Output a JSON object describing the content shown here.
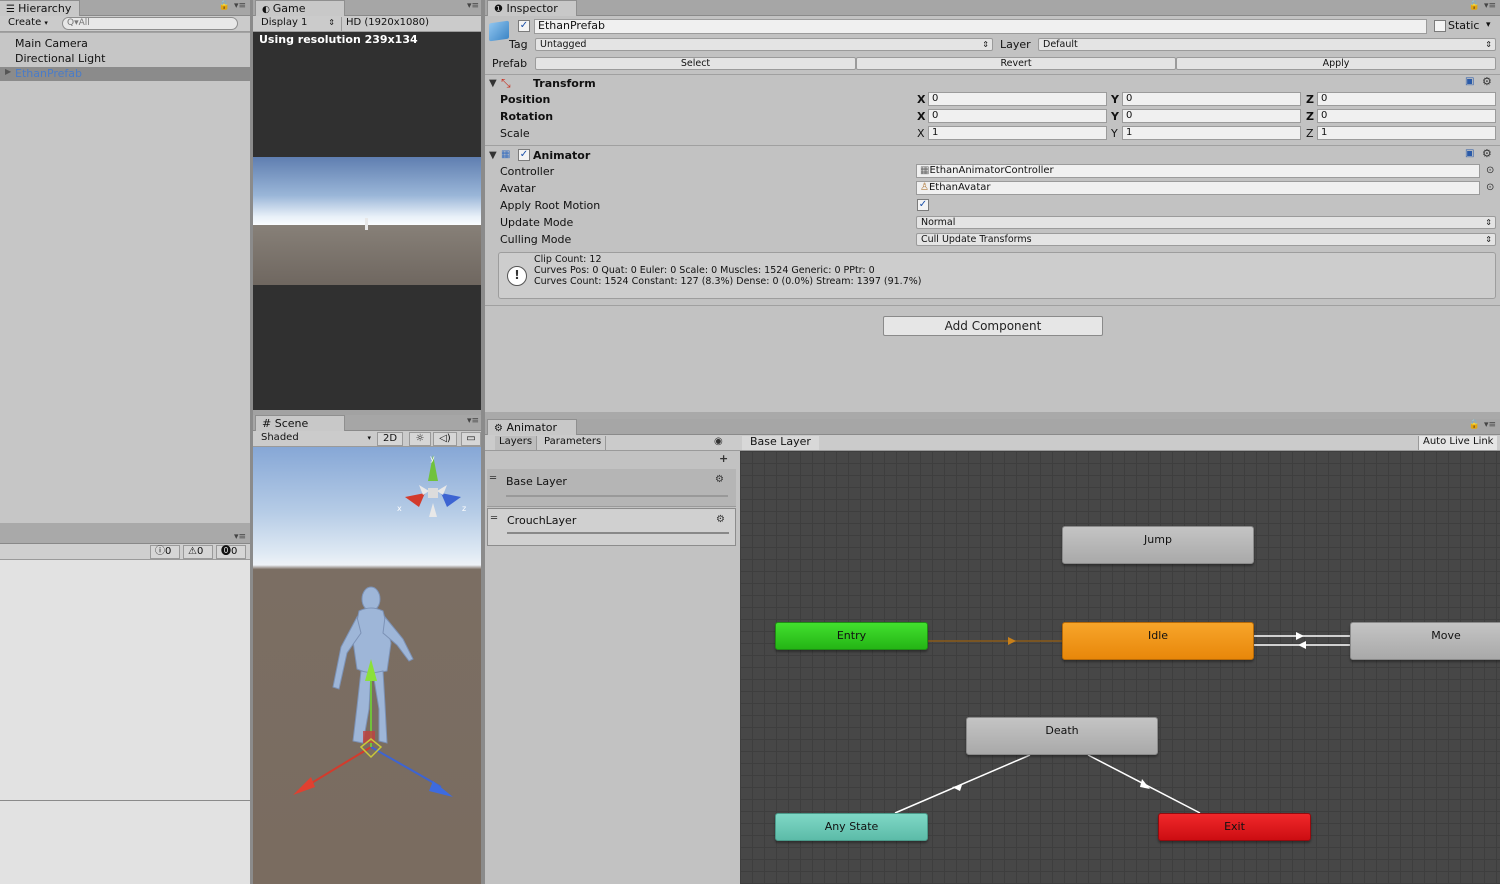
{
  "hierarchy": {
    "tab": "Hierarchy",
    "create": "Create",
    "search_placeholder": "Q▾All",
    "items": [
      "Main Camera",
      "Directional Light",
      "EthanPrefab"
    ]
  },
  "console_counts": {
    "info": "0",
    "warn": "0",
    "error": "0"
  },
  "game": {
    "tab": "Game",
    "display": "Display 1",
    "resolution": "HD (1920x1080)",
    "overlay": "Using resolution 239x134"
  },
  "scene": {
    "tab": "Scene",
    "shading": "Shaded",
    "mode_2d": "2D",
    "gizmo": {
      "y": "y",
      "x": "x",
      "z": "z"
    }
  },
  "inspector": {
    "tab": "Inspector",
    "object_name": "EthanPrefab",
    "static_label": "Static",
    "tag_label": "Tag",
    "tag_value": "Untagged",
    "layer_label": "Layer",
    "layer_value": "Default",
    "prefab_label": "Prefab",
    "prefab_buttons": [
      "Select",
      "Revert",
      "Apply"
    ],
    "transform": {
      "title": "Transform",
      "rows": [
        {
          "label": "Position",
          "x": "0",
          "y": "0",
          "z": "0"
        },
        {
          "label": "Rotation",
          "x": "0",
          "y": "0",
          "z": "0"
        },
        {
          "label": "Scale",
          "x": "1",
          "y": "1",
          "z": "1"
        }
      ]
    },
    "animator": {
      "title": "Animator",
      "controller_label": "Controller",
      "controller_value": "EthanAnimatorController",
      "avatar_label": "Avatar",
      "avatar_value": "EthanAvatar",
      "root_motion_label": "Apply Root Motion",
      "update_mode_label": "Update Mode",
      "update_mode_value": "Normal",
      "culling_mode_label": "Culling Mode",
      "culling_mode_value": "Cull Update Transforms",
      "info_line1": "Clip Count: 12",
      "info_line2": "Curves Pos: 0 Quat: 0 Euler: 0 Scale: 0 Muscles: 1524 Generic: 0 PPtr: 0",
      "info_line3": "Curves Count: 1524 Constant: 127 (8.3%) Dense: 0 (0.0%) Stream: 1397 (91.7%)"
    },
    "add_component": "Add Component"
  },
  "animator_window": {
    "tab": "Animator",
    "layers_tab": "Layers",
    "parameters_tab": "Parameters",
    "breadcrumb": "Base Layer",
    "auto_live_link": "Auto Live Link",
    "layers": [
      "Base Layer",
      "CrouchLayer"
    ],
    "nodes": {
      "jump": "Jump",
      "entry": "Entry",
      "idle": "Idle",
      "move": "Move",
      "death": "Death",
      "any_state": "Any State",
      "exit": "Exit"
    }
  },
  "colors": {
    "entry": "#2fcf1f",
    "idle": "#f29514",
    "any_state": "#6fcbb8",
    "exit": "#e3141a",
    "default_state": "#b0b0b0",
    "graph_bg": "#474747"
  }
}
